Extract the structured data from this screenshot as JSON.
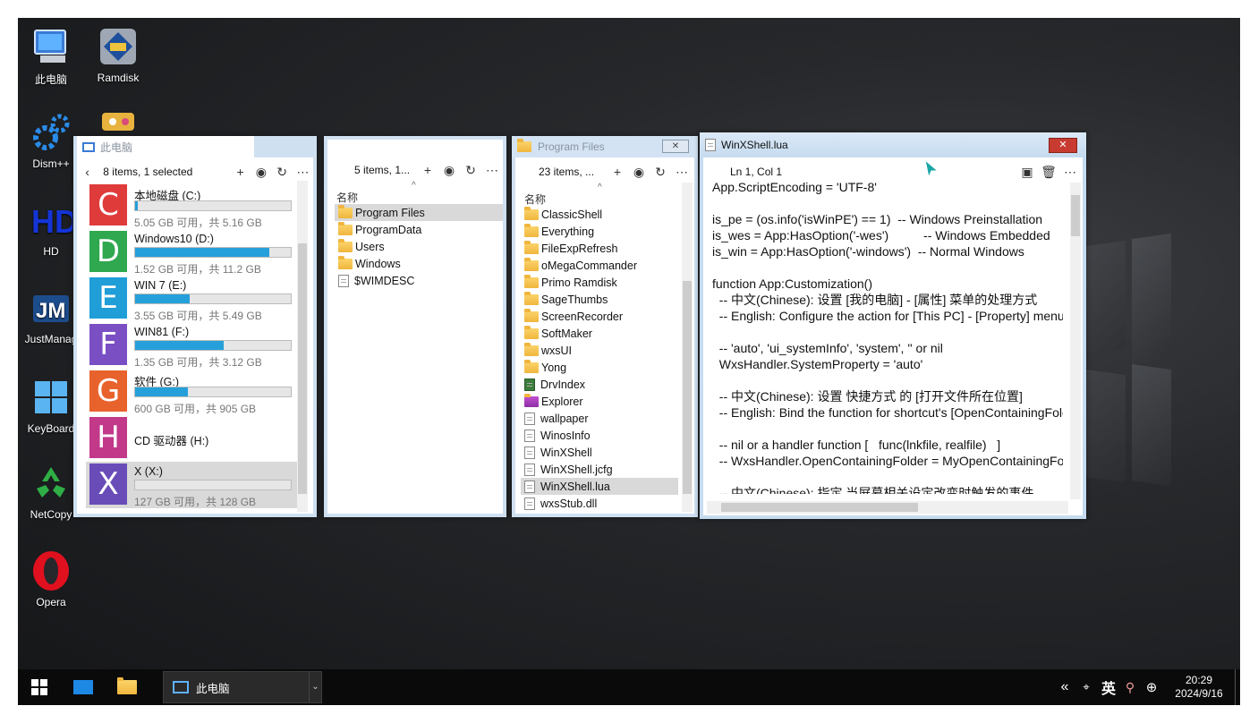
{
  "desktop": {
    "icons": [
      {
        "label": "此电脑",
        "icon": "computer-icon"
      },
      {
        "label": "Ramdisk",
        "icon": "ramdisk-icon"
      },
      {
        "label": "Dism++",
        "icon": "gears-icon"
      },
      {
        "label": "HD",
        "icon": "hd-icon"
      },
      {
        "label": "JustManag",
        "icon": "justmanager-icon"
      },
      {
        "label": "KeyBoard",
        "icon": "keyboard-icon"
      },
      {
        "label": "NetCopy",
        "icon": "recycle-icon"
      },
      {
        "label": "Opera",
        "icon": "opera-icon"
      }
    ]
  },
  "pc_window": {
    "title": "此电脑",
    "status": "8 items, 1 selected",
    "drives": [
      {
        "letter": "C",
        "name": "本地磁盘 (C:)",
        "size": "5.05 GB 可用，共 5.16 GB",
        "used": 0.02,
        "color": "#e03b3b"
      },
      {
        "letter": "D",
        "name": "Windows10 (D:)",
        "size": "1.52 GB 可用，共 11.2 GB",
        "used": 0.86,
        "color": "#2fa84f"
      },
      {
        "letter": "E",
        "name": "WIN 7 (E:)",
        "size": "3.55 GB 可用，共 5.49 GB",
        "used": 0.35,
        "color": "#1f9ed8"
      },
      {
        "letter": "F",
        "name": "WIN81 (F:)",
        "size": "1.35 GB 可用，共 3.12 GB",
        "used": 0.57,
        "color": "#7b4fc4"
      },
      {
        "letter": "G",
        "name": "软件 (G:)",
        "size": "600 GB 可用，共 905 GB",
        "used": 0.34,
        "color": "#e8622c"
      },
      {
        "letter": "H",
        "name": "CD 驱动器 (H:)",
        "size": "",
        "used": 0,
        "color": "#c2398a"
      },
      {
        "letter": "X",
        "name": "X (X:)",
        "size": "127 GB 可用，共 128 GB",
        "used": 0.0,
        "color": "#6a4cb8"
      }
    ]
  },
  "root_window": {
    "status": "5 items, 1...",
    "col_name": "名称",
    "items": [
      {
        "name": "Program Files",
        "type": "folder",
        "selected": true
      },
      {
        "name": "ProgramData",
        "type": "folder"
      },
      {
        "name": "Users",
        "type": "folder"
      },
      {
        "name": "Windows",
        "type": "folder"
      },
      {
        "name": "$WIMDESC",
        "type": "file"
      }
    ]
  },
  "pf_window": {
    "title": "Program Files",
    "status": "23 items, ...",
    "col_name": "名称",
    "items": [
      {
        "name": "ClassicShell",
        "type": "folder"
      },
      {
        "name": "Everything",
        "type": "folder"
      },
      {
        "name": "FileExpRefresh",
        "type": "folder"
      },
      {
        "name": "oMegaCommander",
        "type": "folder"
      },
      {
        "name": "Primo Ramdisk",
        "type": "folder"
      },
      {
        "name": "SageThumbs",
        "type": "folder"
      },
      {
        "name": "ScreenRecorder",
        "type": "folder"
      },
      {
        "name": "SoftMaker",
        "type": "folder"
      },
      {
        "name": "wxsUI",
        "type": "folder"
      },
      {
        "name": "Yong",
        "type": "folder"
      },
      {
        "name": "DrvIndex",
        "type": "app"
      },
      {
        "name": "Explorer",
        "type": "purple"
      },
      {
        "name": "wallpaper",
        "type": "file"
      },
      {
        "name": "WinosInfo",
        "type": "file"
      },
      {
        "name": "WinXShell",
        "type": "file"
      },
      {
        "name": "WinXShell.jcfg",
        "type": "file"
      },
      {
        "name": "WinXShell.lua",
        "type": "file",
        "selected": true
      },
      {
        "name": "wxsStub.dll",
        "type": "file"
      }
    ]
  },
  "editor_window": {
    "title": "WinXShell.lua",
    "position": "Ln 1, Col 1",
    "lines": [
      "App.ScriptEncoding = 'UTF-8'",
      "",
      "is_pe = (os.info('isWinPE') == 1)  -- Windows Preinstallation",
      "is_wes = App:HasOption('-wes')          -- Windows Embedded",
      "is_win = App:HasOption('-windows')  -- Normal Windows",
      "",
      "function App:Customization()",
      "  -- 中文(Chinese): 设置 [我的电脑] - [属性] 菜单的处理方式",
      "  -- English: Configure the action for [This PC] - [Property] menu",
      "",
      "  -- 'auto', 'ui_systemInfo', 'system', '' or nil",
      "  WxsHandler.SystemProperty = 'auto'",
      "",
      "  -- 中文(Chinese): 设置 快捷方式 的 [打开文件所在位置]",
      "  -- English: Bind the function for shortcut's [OpenContainingFolder]",
      "",
      "  -- nil or a handler function [   func(lnkfile, realfile)   ]",
      "  -- WxsHandler.OpenContainingFolder = MyOpenContainingFolder",
      "",
      "  -- 中文(Chinese): 指定 当屏幕相关设定改变时触发的事件"
    ]
  },
  "taskbar": {
    "task_label": "此电脑",
    "ime": "英",
    "time": "20:29",
    "date": "2024/9/16"
  }
}
